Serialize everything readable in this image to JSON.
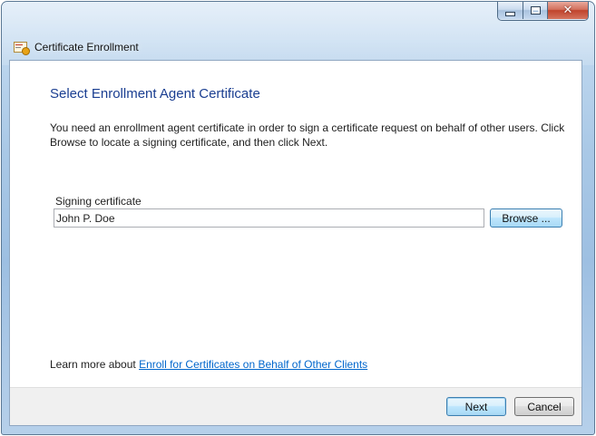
{
  "window": {
    "title": "Certificate Enrollment",
    "icon": "certificate-icon",
    "controls": [
      "minimize-icon",
      "maximize-icon",
      "close-icon"
    ]
  },
  "page": {
    "heading": "Select Enrollment Agent Certificate",
    "description": "You need an enrollment agent certificate in order to sign a certificate request on behalf of other users. Click Browse to locate a signing certificate, and then click Next."
  },
  "signing": {
    "label": "Signing certificate",
    "value": "John P. Doe",
    "browse_label": "Browse ..."
  },
  "learn_more": {
    "prefix": "Learn more about ",
    "link_text": "Enroll for Certificates on Behalf of Other Clients"
  },
  "footer": {
    "next_label": "Next",
    "cancel_label": "Cancel"
  },
  "colors": {
    "heading": "#1a3e91",
    "link": "#0066cc",
    "frame": "#a9c8e6"
  }
}
